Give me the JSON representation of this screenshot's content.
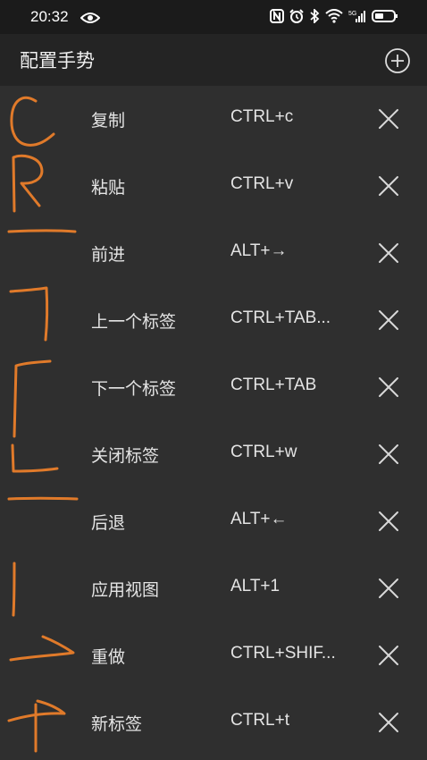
{
  "status_bar": {
    "time": "20:32",
    "icons": [
      "eye-icon",
      "nfc-icon",
      "alarm-icon",
      "bluetooth-icon",
      "wifi-icon",
      "signal-5g-icon",
      "battery-icon"
    ]
  },
  "header": {
    "title": "配置手势",
    "add_icon": "plus-circle-icon"
  },
  "gestures": [
    {
      "name": "复制",
      "shortcut": "CTRL+c"
    },
    {
      "name": "粘贴",
      "shortcut": "CTRL+v"
    },
    {
      "name": "前进",
      "shortcut": "ALT+→"
    },
    {
      "name": "上一个标签",
      "shortcut": "CTRL+TAB..."
    },
    {
      "name": "下一个标签",
      "shortcut": "CTRL+TAB"
    },
    {
      "name": "关闭标签",
      "shortcut": "CTRL+w"
    },
    {
      "name": "后退",
      "shortcut": "ALT+←"
    },
    {
      "name": "应用视图",
      "shortcut": "ALT+1"
    },
    {
      "name": "重做",
      "shortcut": "CTRL+SHIF..."
    },
    {
      "name": "新标签",
      "shortcut": "CTRL+t"
    }
  ],
  "colors": {
    "background": "#2f2f2f",
    "header": "#242424",
    "status_bar": "#1b1b1b",
    "gesture_stroke": "#e07a2a",
    "text": "#e4e4e4"
  }
}
